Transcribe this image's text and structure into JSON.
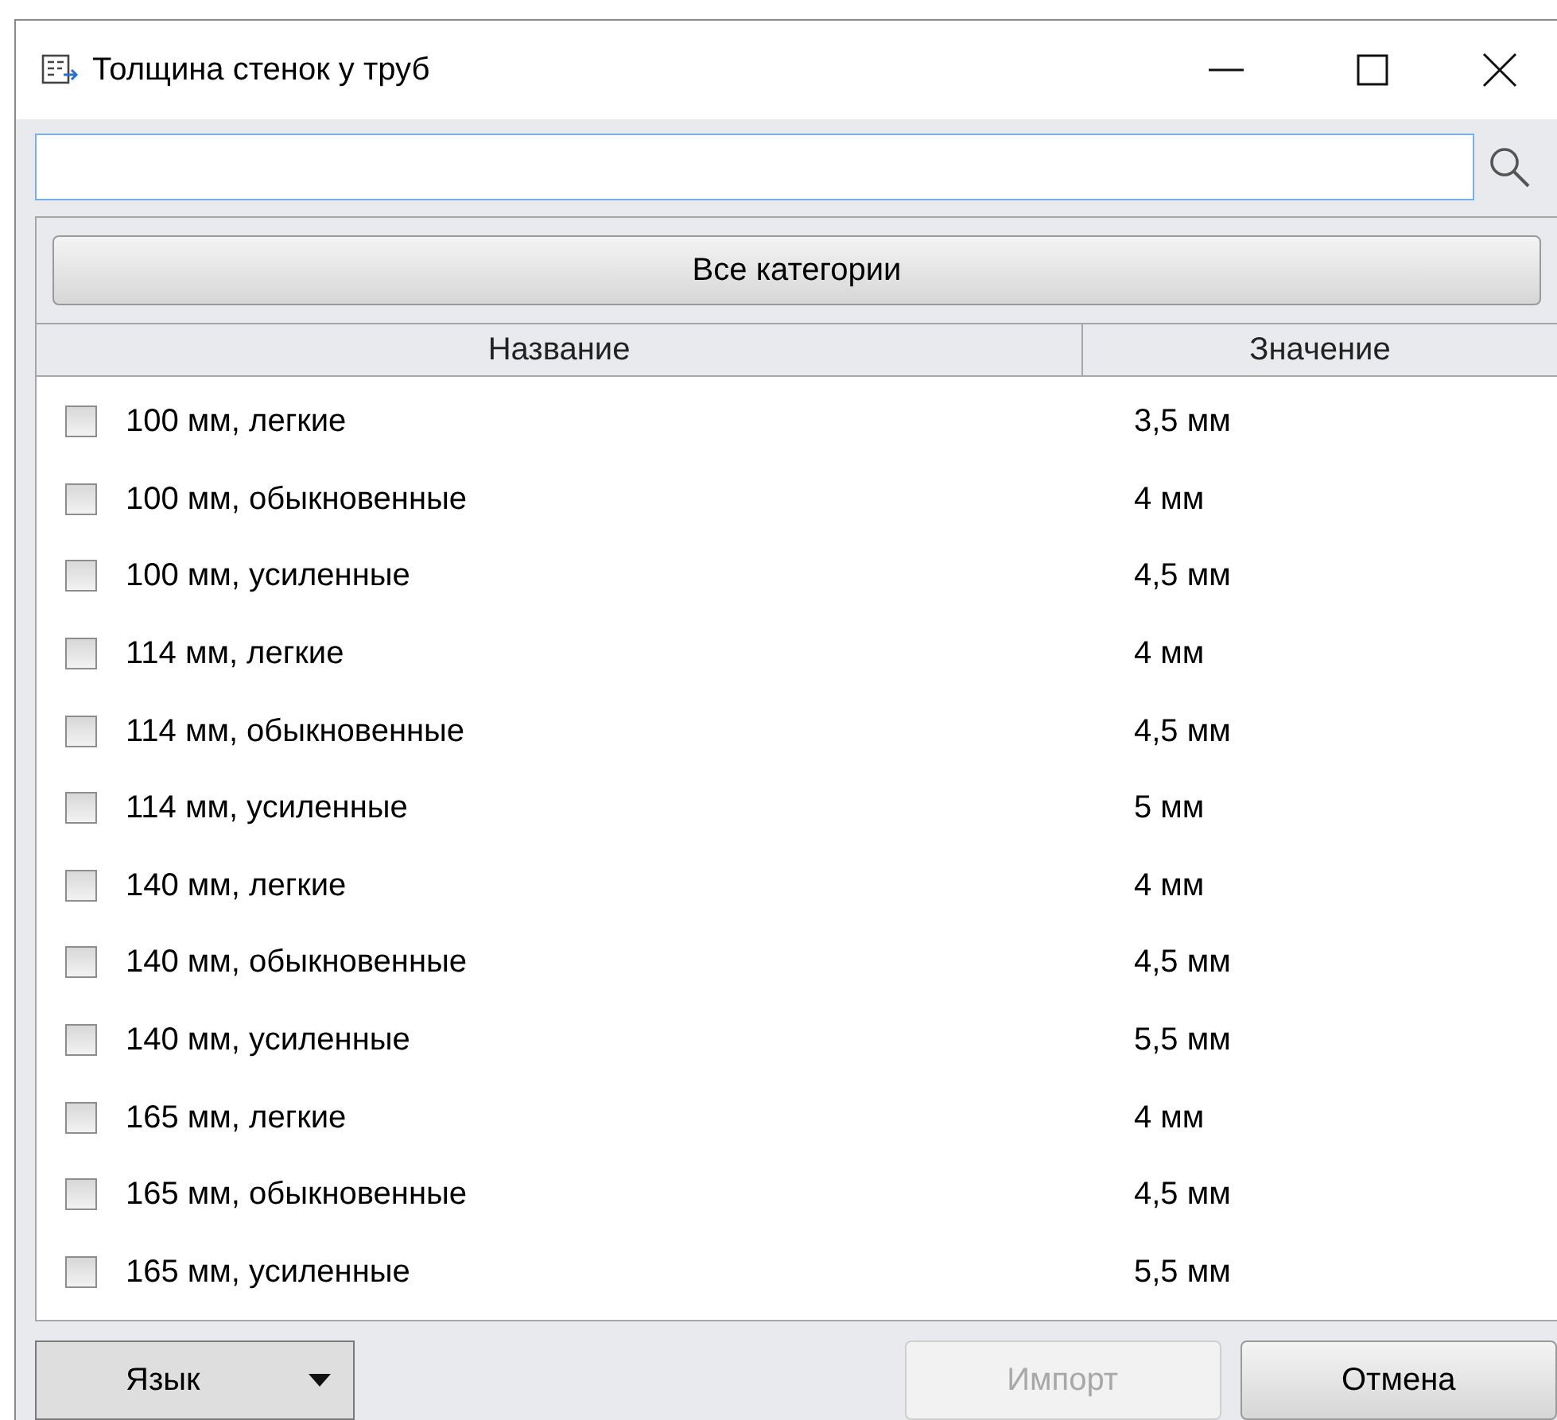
{
  "window": {
    "title": "Толщина стенок у труб"
  },
  "category_button": "Все категории",
  "table": {
    "columns": [
      "Название",
      "Значение"
    ],
    "rows": [
      {
        "name": "100 мм, легкие",
        "value": "3,5 мм",
        "checked": false
      },
      {
        "name": "100 мм, обыкновенные",
        "value": "4 мм",
        "checked": false
      },
      {
        "name": "100 мм, усиленные",
        "value": "4,5 мм",
        "checked": false
      },
      {
        "name": "114 мм, легкие",
        "value": "4 мм",
        "checked": false
      },
      {
        "name": "114 мм, обыкновенные",
        "value": "4,5 мм",
        "checked": false
      },
      {
        "name": "114 мм, усиленные",
        "value": "5 мм",
        "checked": false
      },
      {
        "name": "140 мм, легкие",
        "value": "4 мм",
        "checked": false
      },
      {
        "name": "140 мм, обыкновенные",
        "value": "4,5 мм",
        "checked": false
      },
      {
        "name": "140 мм, усиленные",
        "value": "5,5 мм",
        "checked": false
      },
      {
        "name": "165 мм, легкие",
        "value": "4 мм",
        "checked": false
      },
      {
        "name": "165 мм, обыкновенные",
        "value": "4,5 мм",
        "checked": false
      },
      {
        "name": "165 мм, усиленные",
        "value": "5,5 мм",
        "checked": false
      }
    ]
  },
  "footer": {
    "language_button": "Язык",
    "import_button": {
      "label": "Импорт",
      "disabled": true
    },
    "cancel_button": "Отмена"
  }
}
